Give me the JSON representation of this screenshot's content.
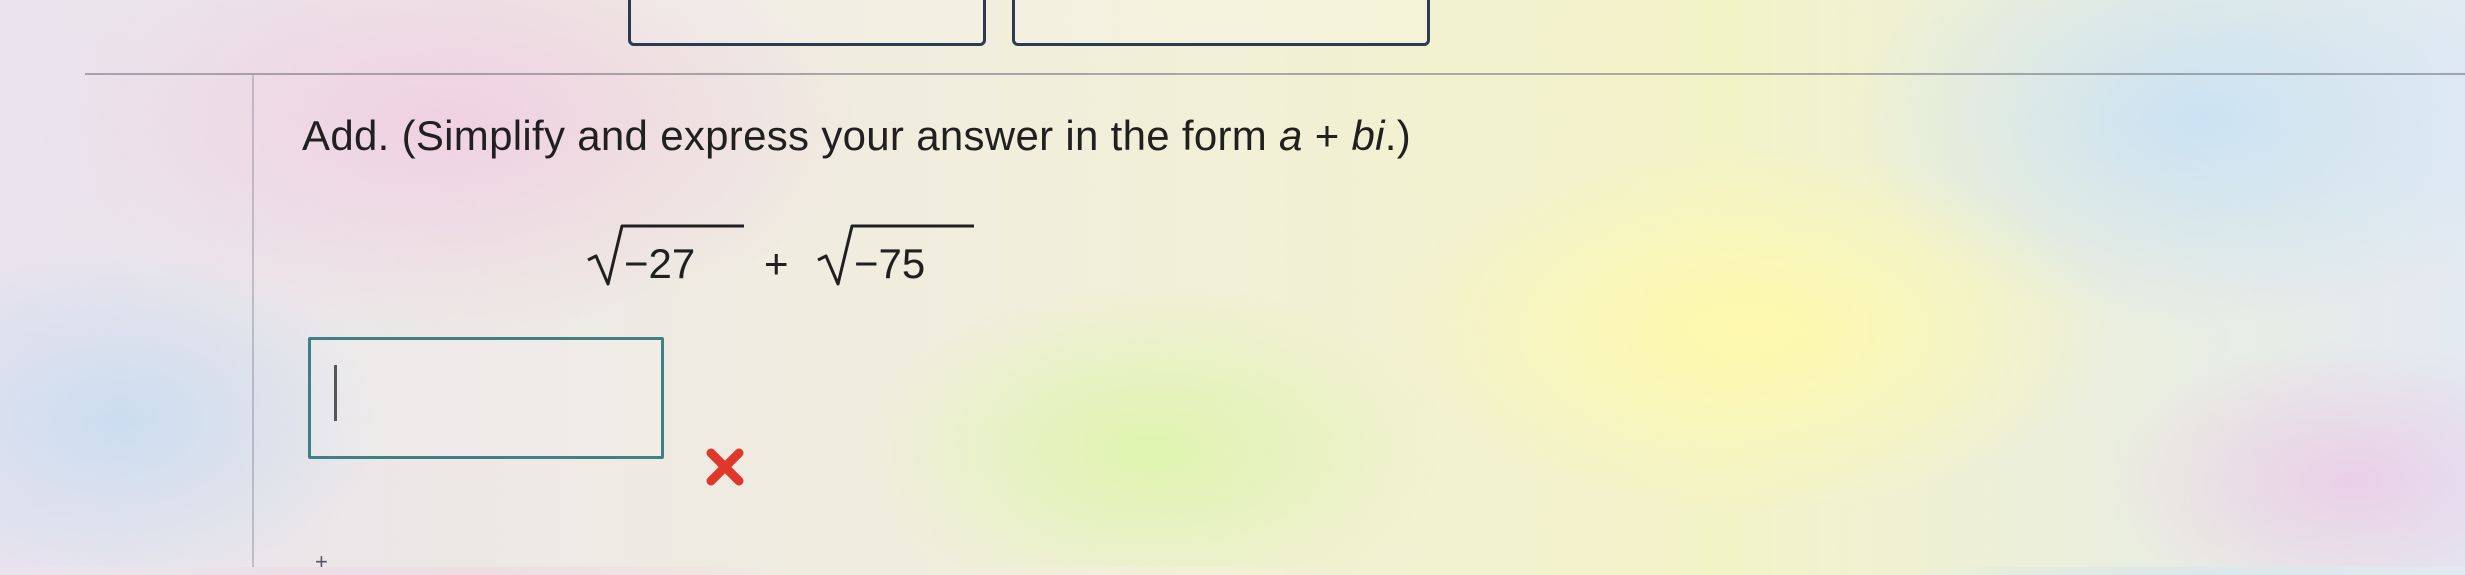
{
  "question": {
    "prefix": "Add. (Simplify and express your answer in the form ",
    "var_a": "a",
    "plus": " + ",
    "var_bi": "bi",
    "suffix": ".)"
  },
  "expression": {
    "term1": "−27",
    "operator": "+",
    "term2": "−75"
  },
  "answer": {
    "value": "",
    "status": "incorrect"
  },
  "colors": {
    "answer_border": "#3f7f86",
    "incorrect_mark": "#e0372a",
    "text": "#202020"
  },
  "icons": {
    "feedback": "incorrect-x-icon",
    "radical": "square-root-icon"
  }
}
